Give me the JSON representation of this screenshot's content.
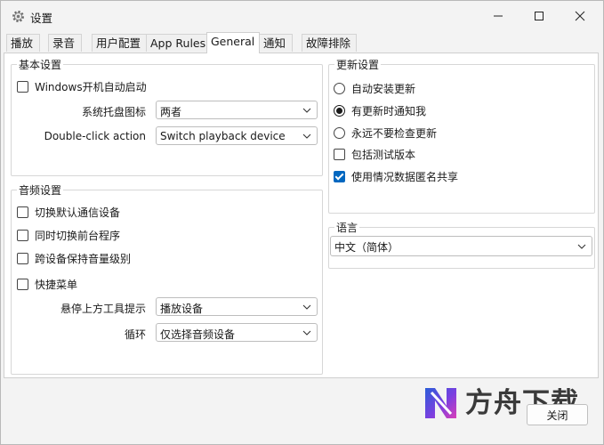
{
  "window": {
    "title": "设置"
  },
  "tabs": [
    {
      "label": "播放"
    },
    {
      "label": "录音"
    },
    {
      "label": "用户配置"
    },
    {
      "label": "App Rules"
    },
    {
      "label": "General",
      "active": true
    },
    {
      "label": "通知"
    },
    {
      "label": "故障排除"
    }
  ],
  "basic": {
    "title": "基本设置",
    "autostart_label": "Windows开机自动启动",
    "autostart_checked": false,
    "tray_label": "系统托盘图标",
    "tray_value": "两者",
    "dblclick_label": "Double-click action",
    "dblclick_value": "Switch playback device"
  },
  "update": {
    "title": "更新设置",
    "options": [
      {
        "label": "自动安装更新",
        "checked": false
      },
      {
        "label": "有更新时通知我",
        "checked": true
      },
      {
        "label": "永远不要检查更新",
        "checked": false
      }
    ],
    "beta_label": "包括测试版本",
    "beta_checked": false,
    "share_label": "使用情况数据匿名共享",
    "share_checked": true
  },
  "audio": {
    "title": "音频设置",
    "checks": [
      {
        "label": "切换默认通信设备",
        "checked": false
      },
      {
        "label": "同时切换前台程序",
        "checked": false
      },
      {
        "label": "跨设备保持音量级别",
        "checked": false
      },
      {
        "label": "快捷菜单",
        "checked": false
      }
    ],
    "tooltip_label": "悬停上方工具提示",
    "tooltip_value": "播放设备",
    "cycle_label": "循环",
    "cycle_value": "仅选择音频设备"
  },
  "language": {
    "title": "语言",
    "value": "中文（简体）"
  },
  "buttons": {
    "close_label": "关闭"
  },
  "watermark": {
    "text": "方舟下载"
  },
  "colors": {
    "accent": "#0067c0",
    "background": "#f3f3f3",
    "panel": "#ffffff"
  }
}
